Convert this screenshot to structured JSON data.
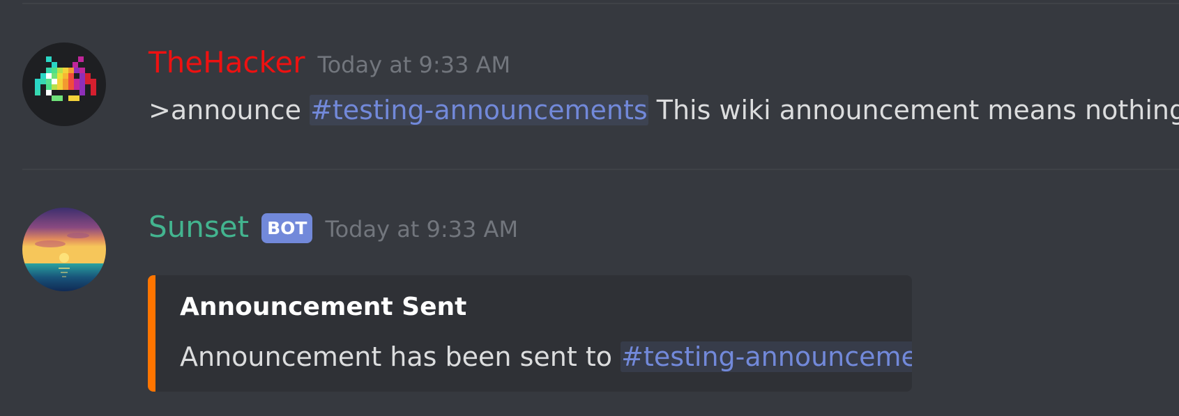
{
  "messages": [
    {
      "author": "TheHacker",
      "author_color": "#ee1111",
      "timestamp": "Today at 9:33 AM",
      "avatar_icon": "space-invader-icon",
      "content": {
        "prefix": ">announce ",
        "mention": "#testing-announcements",
        "suffix": " This wiki announcement means nothing"
      }
    },
    {
      "author": "Sunset",
      "author_color": "#43b48f",
      "bot_tag": "BOT",
      "timestamp": "Today at 9:33 AM",
      "avatar_icon": "sunset-icon",
      "embed": {
        "accent_color": "#ff7500",
        "title": "Announcement Sent",
        "description_prefix": "Announcement has been sent to ",
        "description_mention": "#testing-announcements"
      }
    }
  ],
  "colors": {
    "background": "#36393f",
    "mention": "#7289da",
    "timestamp": "#72767d",
    "embed_background": "#2f3136"
  }
}
